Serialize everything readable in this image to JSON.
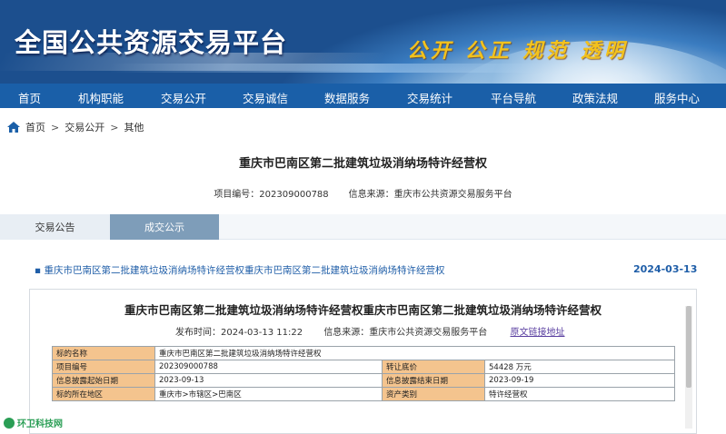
{
  "header": {
    "site_title": "全国公共资源交易平台",
    "slogan": "公开 公正 规范 透明"
  },
  "nav": {
    "items": [
      "首页",
      "机构职能",
      "交易公开",
      "交易诚信",
      "数据服务",
      "交易统计",
      "平台导航",
      "政策法规",
      "服务中心"
    ]
  },
  "breadcrumb": {
    "items": [
      "首页",
      "交易公开",
      "其他"
    ],
    "separator": ">"
  },
  "page": {
    "title": "重庆市巴南区第二批建筑垃圾消纳场特许经营权",
    "project_no": "项目编号：202309000788",
    "source": "信息来源：重庆市公共资源交易服务平台"
  },
  "tabs": [
    {
      "label": "交易公告",
      "active": false
    },
    {
      "label": "成交公示",
      "active": true
    }
  ],
  "notice": {
    "link_text": "▪ 重庆市巴南区第二批建筑垃圾消纳场特许经营权重庆市巴南区第二批建筑垃圾消纳场特许经营权",
    "date": "2024-03-13"
  },
  "doc": {
    "title": "重庆市巴南区第二批建筑垃圾消纳场特许经营权重庆市巴南区第二批建筑垃圾消纳场特许经营权",
    "publish_time": "发布时间：2024-03-13 11:22",
    "source": "信息来源：重庆市公共资源交易服务平台",
    "original_link": "原文链接地址",
    "table": {
      "r1": {
        "k": "标的名称",
        "v": "重庆市巴南区第二批建筑垃圾消纳场特许经营权"
      },
      "r2": {
        "k": "项目编号",
        "v": "202309000788",
        "k2": "转让底价",
        "v2": "54428 万元"
      },
      "r3": {
        "k": "信息披露起始日期",
        "v": "2023-09-13",
        "k2": "信息披露结束日期",
        "v2": "2023-09-19"
      },
      "r4": {
        "k": "标的所在地区",
        "v": "重庆市>市辖区>巴南区",
        "k2": "资产类别",
        "v2": "特许经营权"
      }
    }
  },
  "watermark": {
    "text": "环卫科技网"
  },
  "colors": {
    "nav_bg": "#1a5fa8",
    "link": "#1f5ea8",
    "header_cell": "#f4c48e",
    "tab_active": "#7e9db9"
  }
}
